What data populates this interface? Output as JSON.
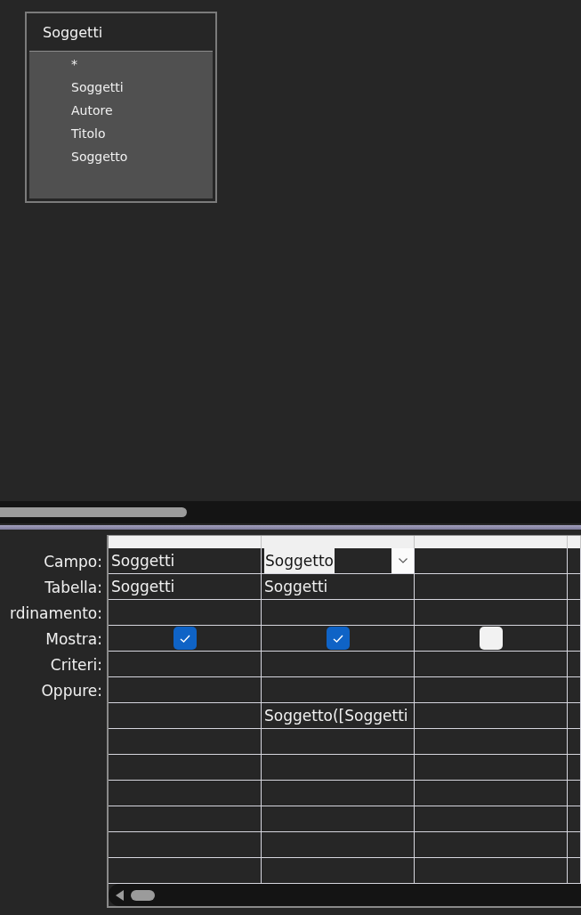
{
  "table_window": {
    "title": "Soggetti",
    "fields": [
      "*",
      "Soggetti",
      "Autore",
      "Titolo",
      "Soggetto"
    ]
  },
  "design_grid": {
    "rows": [
      {
        "label": "Campo:",
        "kind": "text",
        "cells": [
          {
            "value": "Soggetti",
            "selected": false
          },
          {
            "value": "Soggetto",
            "selected": true
          },
          {
            "selected": false
          },
          {
            "selected": false
          }
        ]
      },
      {
        "label": "Tabella:",
        "kind": "text",
        "cells": [
          {
            "value": "Soggetti"
          },
          {
            "value": "Soggetti"
          },
          {},
          {}
        ]
      },
      {
        "label": "rdinamento:",
        "kind": "text",
        "cells": [
          {},
          {},
          {},
          {}
        ]
      },
      {
        "label": "Mostra:",
        "kind": "checkbox",
        "cells": [
          {
            "checked": true
          },
          {
            "checked": true
          },
          {
            "checked": false
          },
          {}
        ]
      },
      {
        "label": "Criteri:",
        "kind": "text",
        "cells": [
          {},
          {},
          {},
          {}
        ]
      },
      {
        "label": "Oppure:",
        "kind": "text",
        "cells": [
          {},
          {},
          {},
          {}
        ]
      },
      {
        "kind": "text",
        "cells": [
          {},
          {
            "value": "Soggetto([Soggetti"
          },
          {},
          {}
        ]
      },
      {
        "kind": "text",
        "cells": [
          {},
          {},
          {},
          {}
        ]
      },
      {
        "kind": "text",
        "cells": [
          {},
          {},
          {},
          {}
        ]
      },
      {
        "kind": "text",
        "cells": [
          {},
          {},
          {},
          {}
        ]
      },
      {
        "kind": "text",
        "cells": [
          {},
          {},
          {},
          {}
        ]
      },
      {
        "kind": "text",
        "cells": [
          {},
          {},
          {},
          {}
        ]
      },
      {
        "kind": "text",
        "cells": [
          {},
          {},
          {},
          {}
        ]
      }
    ]
  }
}
